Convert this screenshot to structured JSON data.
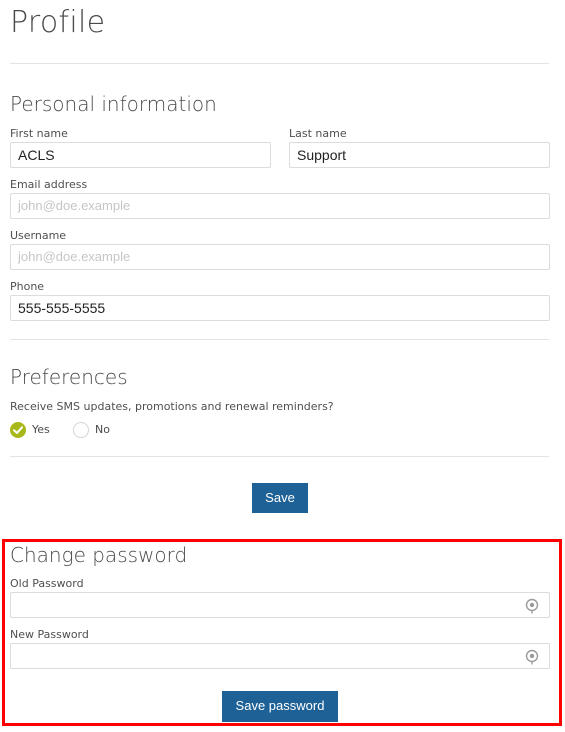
{
  "page": {
    "title": "Profile"
  },
  "personal": {
    "heading": "Personal information",
    "first_name": {
      "label": "First name",
      "value": "ACLS"
    },
    "last_name": {
      "label": "Last name",
      "value": "Support"
    },
    "email": {
      "label": "Email address",
      "placeholder": "john@doe.example"
    },
    "username": {
      "label": "Username",
      "placeholder": "john@doe.example"
    },
    "phone": {
      "label": "Phone",
      "value": "555-555-5555"
    }
  },
  "preferences": {
    "heading": "Preferences",
    "question": "Receive SMS updates, promotions and renewal reminders?",
    "options": [
      {
        "label": "Yes",
        "selected": true
      },
      {
        "label": "No",
        "selected": false
      }
    ],
    "save_label": "Save"
  },
  "password": {
    "heading": "Change password",
    "old_label": "Old Password",
    "new_label": "New Password",
    "save_label": "Save password",
    "reveal_icon": "eye-icon"
  },
  "colors": {
    "primary_button": "#1d6196",
    "radio_selected": "#a8b81b",
    "highlight_border": "#ff0000"
  }
}
